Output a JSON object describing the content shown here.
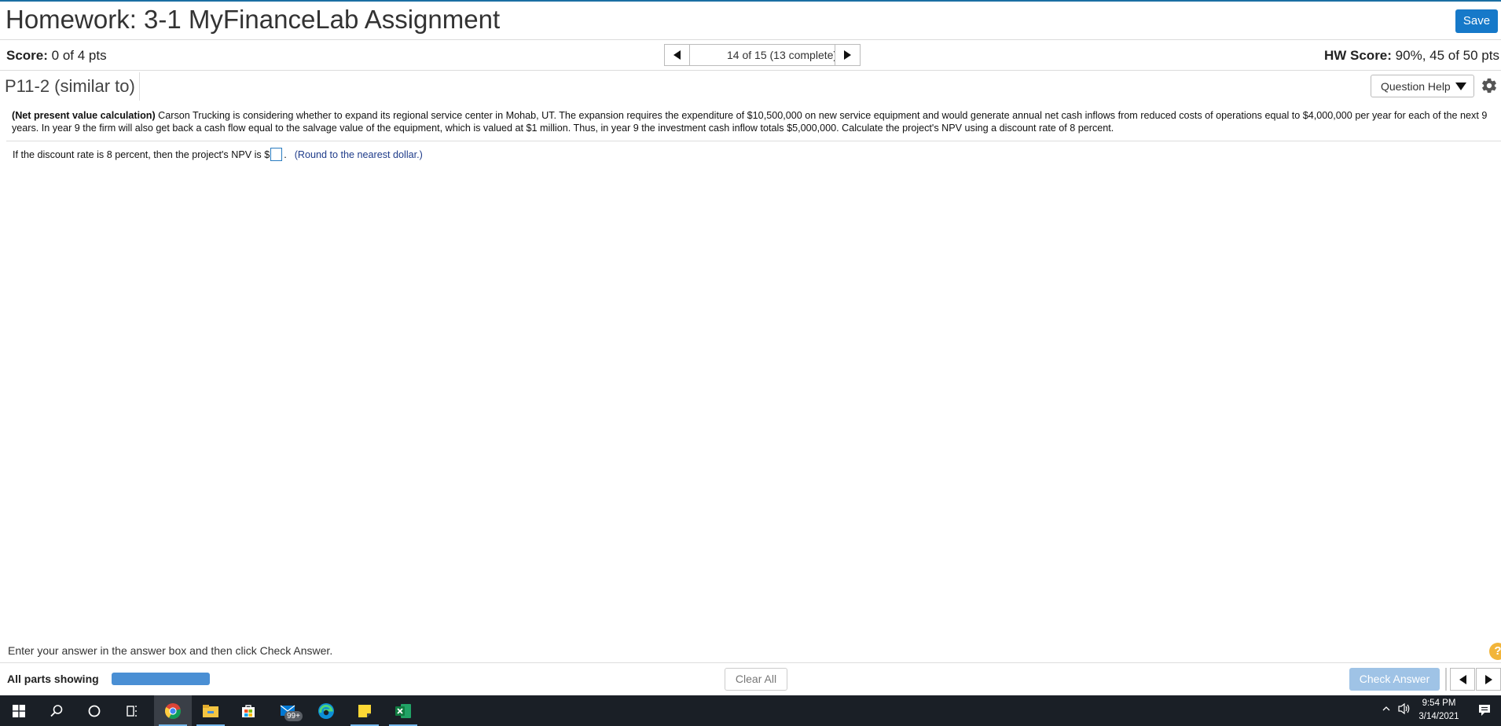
{
  "header": {
    "title": "Homework: 3-1 MyFinanceLab Assignment",
    "save_label": "Save"
  },
  "scorebar": {
    "score_label": "Score:",
    "score_value": "0 of 4 pts",
    "nav_counter": "14 of 15 (13 complete)",
    "hw_score_label": "HW Score:",
    "hw_score_value": "90%, 45 of 50 pts"
  },
  "question": {
    "id": "P11-2 (similar to)",
    "help_label": "Question Help",
    "problem_title": "(Net present value calculation)",
    "problem_text": "Carson Trucking is considering whether to expand its regional service center in Mohab, UT.  The expansion requires the expenditure of $10,500,000 on new service equipment and would generate annual net cash inflows from reduced costs of operations equal to $4,000,000 per year for each of the next 9 years.  In year 9 the firm will also get back a cash flow equal to the salvage value of the equipment, which is valued at $1 million.  Thus, in year 9 the investment cash inflow totals $5,000,000.  Calculate the project's NPV using a discount rate of 8 percent.",
    "answer_prefix": "If the discount rate is 8 percent, then the project's NPV is $",
    "answer_value": "",
    "answer_suffix": ".",
    "round_hint": "(Round to the nearest dollar.)"
  },
  "footer": {
    "instruction": "Enter your answer in the answer box and then click Check Answer.",
    "help_glyph": "?",
    "parts_label": "All parts showing",
    "clear_label": "Clear All",
    "check_label": "Check Answer"
  },
  "taskbar": {
    "mail_badge": "99+",
    "time": "9:54 PM",
    "date": "3/14/2021"
  },
  "colors": {
    "accent": "#1679c9",
    "check_disabled": "#9fc3e6",
    "progress": "#4a8fd4",
    "taskbar": "#1a1f26"
  },
  "icons": [
    "triangle-left-icon",
    "triangle-right-icon",
    "dropdown-caret-icon",
    "gear-icon",
    "help-circle-icon",
    "windows-start-icon",
    "search-icon",
    "cortana-icon",
    "task-view-icon",
    "chrome-icon",
    "file-explorer-icon",
    "store-icon",
    "mail-icon",
    "edge-icon",
    "sticky-notes-icon",
    "excel-icon",
    "tray-chevron-icon",
    "volume-icon",
    "notification-icon"
  ]
}
